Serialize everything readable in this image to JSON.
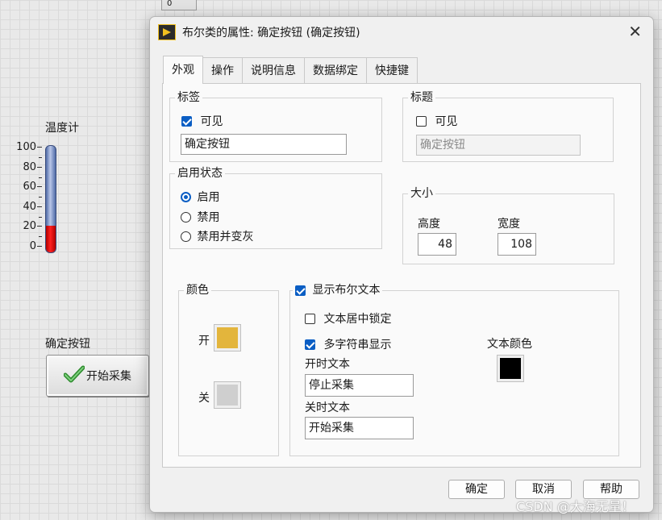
{
  "front_panel": {
    "top_indicator": "0",
    "thermometer": {
      "label": "温度计",
      "ticks": [
        "100",
        "80",
        "60",
        "40",
        "20",
        "0"
      ],
      "value": 25
    },
    "bool_button": {
      "label": "确定按钮",
      "text": "开始采集"
    }
  },
  "dialog": {
    "title": "布尔类的属性: 确定按钮 (确定按钮)",
    "tabs": [
      "外观",
      "操作",
      "说明信息",
      "数据绑定",
      "快捷键"
    ],
    "active_tab": 0,
    "label_group": {
      "title": "标签",
      "visible_label": "可见",
      "visible_checked": true,
      "value": "确定按钮"
    },
    "caption_group": {
      "title": "标题",
      "visible_label": "可见",
      "visible_checked": false,
      "value": "确定按钮"
    },
    "enable_group": {
      "title": "启用状态",
      "options": [
        "启用",
        "禁用",
        "禁用并变灰"
      ],
      "selected": 0
    },
    "size_group": {
      "title": "大小",
      "height_label": "高度",
      "height_value": "48",
      "width_label": "宽度",
      "width_value": "108"
    },
    "color_group": {
      "title": "颜色",
      "on_label": "开",
      "off_label": "关",
      "on_color": "#e3b53c",
      "off_color": "#cfcfcf"
    },
    "bool_text_group": {
      "title": "显示布尔文本",
      "title_checked": true,
      "center_lock_label": "文本居中锁定",
      "center_lock_checked": false,
      "multi_string_label": "多字符串显示",
      "multi_string_checked": true,
      "on_text_label": "开时文本",
      "on_text_value": "停止采集",
      "off_text_label": "关时文本",
      "off_text_value": "开始采集",
      "text_color_label": "文本颜色",
      "text_color": "#000000"
    },
    "buttons": {
      "ok": "确定",
      "cancel": "取消",
      "help": "帮助"
    }
  },
  "watermark": "CSDN @大海无量！"
}
